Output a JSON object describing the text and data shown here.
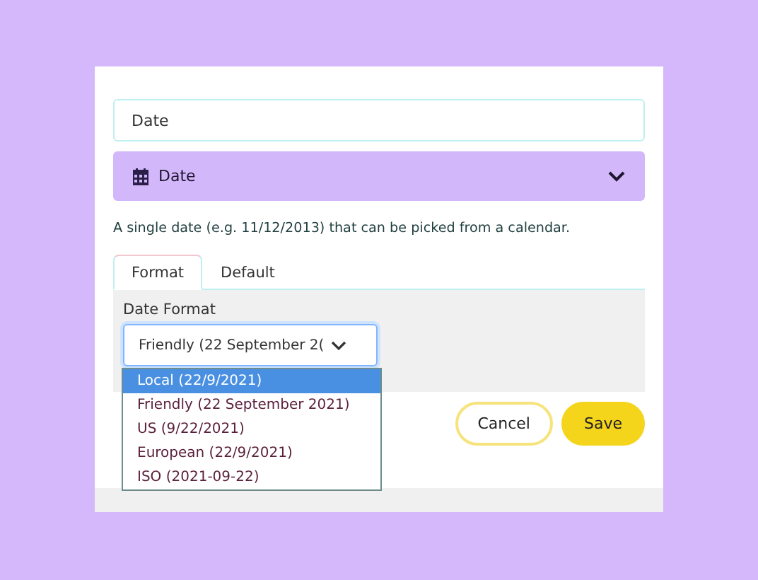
{
  "name_field": {
    "value": "Date"
  },
  "type_select": {
    "value": "Date"
  },
  "description": "A single date (e.g. 11/12/2013) that can be picked from a calendar.",
  "tabs": [
    {
      "label": "Format",
      "selected": true
    },
    {
      "label": "Default",
      "selected": false
    }
  ],
  "format_field": {
    "label": "Date Format",
    "value": "Friendly (22 September 2(",
    "expanded": true,
    "options": [
      {
        "label": "Local (22/9/2021)",
        "selected": true
      },
      {
        "label": "Friendly (22 September 2021)",
        "selected": false
      },
      {
        "label": "US (9/22/2021)",
        "selected": false
      },
      {
        "label": "European (22/9/2021)",
        "selected": false
      },
      {
        "label": "ISO (2021-09-22)",
        "selected": false
      }
    ]
  },
  "buttons": [
    {
      "label": "Cancel",
      "kind": "secondary"
    },
    {
      "label": "Save",
      "kind": "primary"
    }
  ]
}
